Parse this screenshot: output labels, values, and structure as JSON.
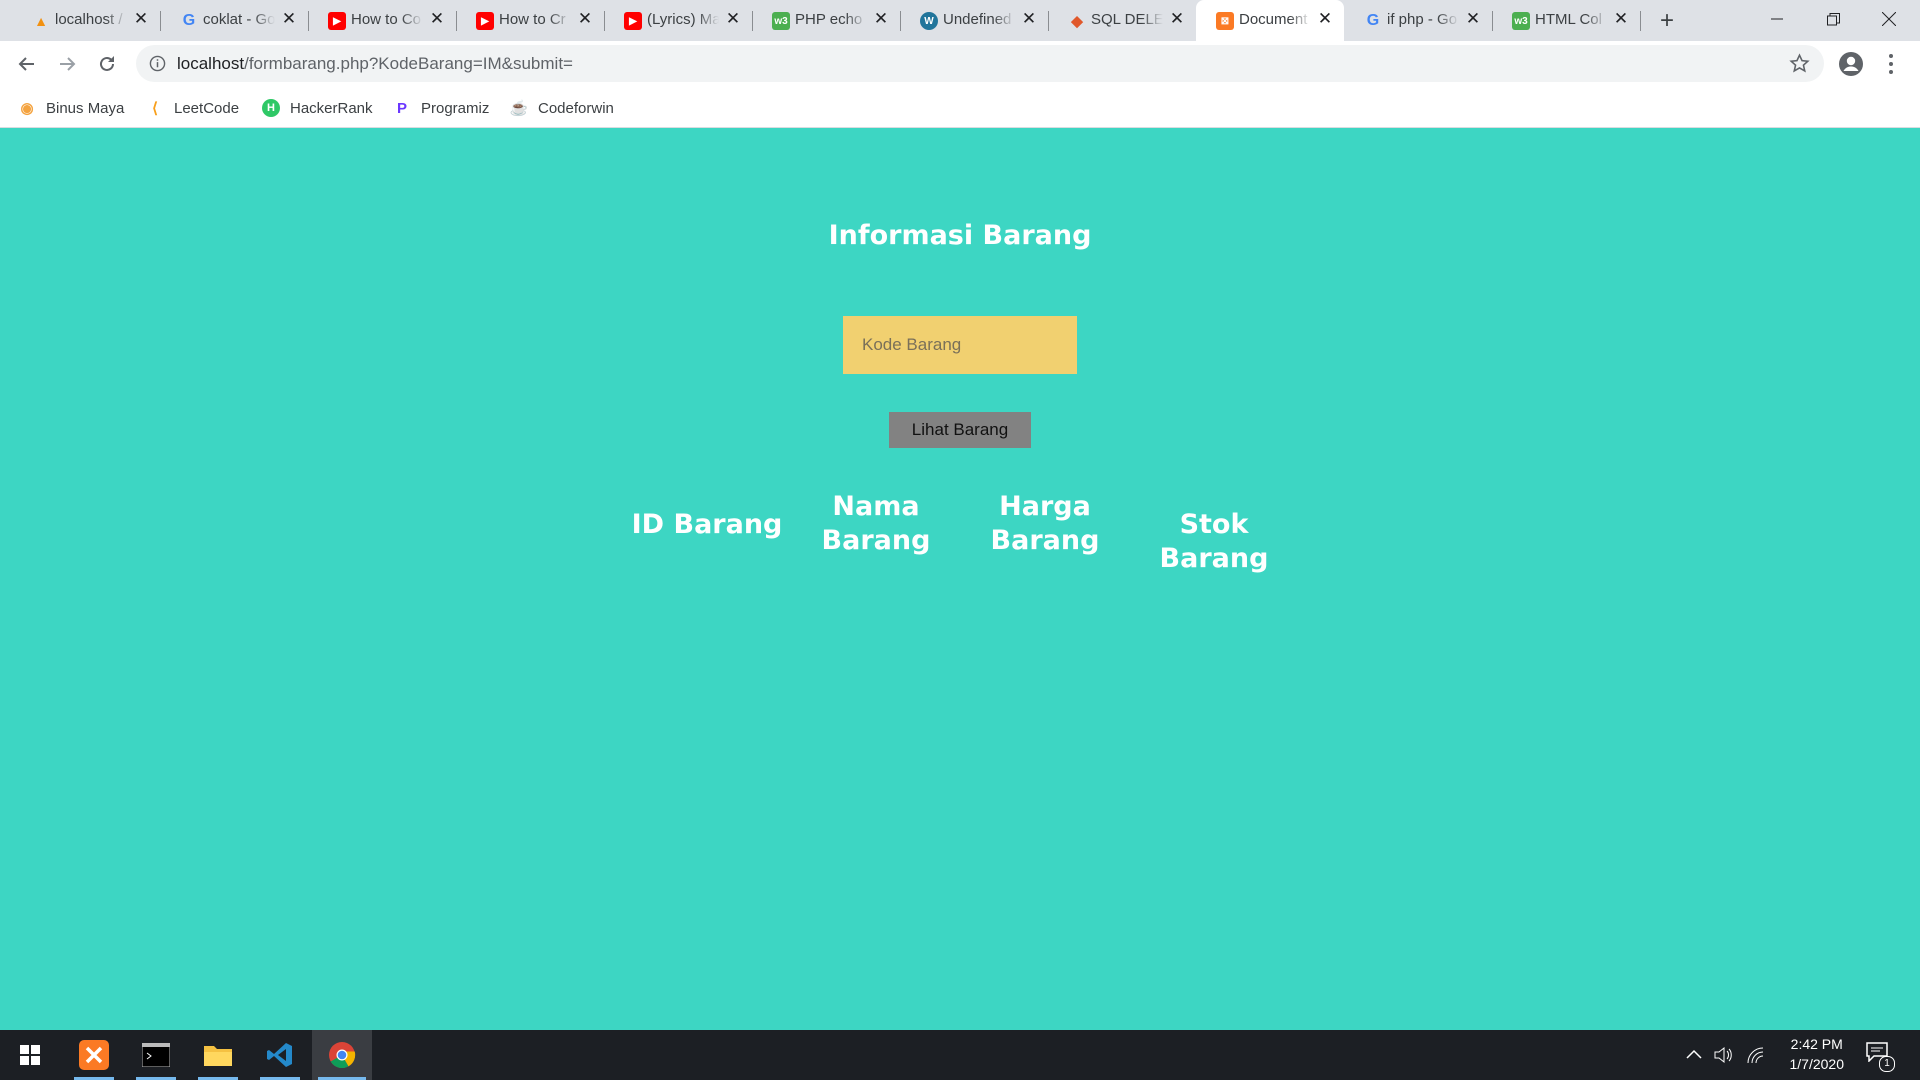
{
  "browser": {
    "tabs": [
      {
        "title": "localhost /",
        "icon": "phpmyadmin-icon",
        "color": "#f29111"
      },
      {
        "title": "coklat - Go",
        "icon": "google-icon",
        "color": "#4285f4"
      },
      {
        "title": "How to Co",
        "icon": "youtube-icon",
        "color": "#ff0000"
      },
      {
        "title": "How to Cr",
        "icon": "youtube-icon",
        "color": "#ff0000"
      },
      {
        "title": "(Lyrics) Ma",
        "icon": "youtube-icon",
        "color": "#ff0000"
      },
      {
        "title": "PHP echo",
        "icon": "w3schools-icon",
        "color": "#4caf50"
      },
      {
        "title": "Undefined",
        "icon": "wordpress-icon",
        "color": "#21759b"
      },
      {
        "title": "SQL DELET",
        "icon": "code-icon",
        "color": "#e0582b"
      },
      {
        "title": "Document",
        "icon": "xampp-icon",
        "color": "#fb7a24",
        "active": true
      },
      {
        "title": "if php - Go",
        "icon": "google-icon",
        "color": "#4285f4"
      },
      {
        "title": "HTML Col",
        "icon": "w3schools-icon",
        "color": "#4caf50"
      }
    ],
    "url_host": "localhost",
    "url_rest": "/formbarang.php?KodeBarang=IM&submit=",
    "bookmarks": [
      {
        "label": "Binus Maya",
        "icon": "binus-icon",
        "color": "#f4a340"
      },
      {
        "label": "LeetCode",
        "icon": "leetcode-icon",
        "color": "#f89f1b"
      },
      {
        "label": "HackerRank",
        "icon": "hackerrank-icon",
        "color": "#2ec866"
      },
      {
        "label": "Programiz",
        "icon": "programiz-icon",
        "color": "#6b37ff"
      },
      {
        "label": "Codeforwin",
        "icon": "codeforwin-icon",
        "color": "#c8102e"
      }
    ]
  },
  "page": {
    "title": "Informasi Barang",
    "input_placeholder": "Kode Barang",
    "button_label": "Lihat Barang",
    "columns": [
      "ID Barang",
      "Nama Barang",
      "Harga Barang",
      "Stok Barang"
    ],
    "background": "#3dd6c3",
    "input_color": "#f1d070"
  },
  "taskbar": {
    "time": "2:42 PM",
    "date": "1/7/2020",
    "notifications": "1"
  }
}
